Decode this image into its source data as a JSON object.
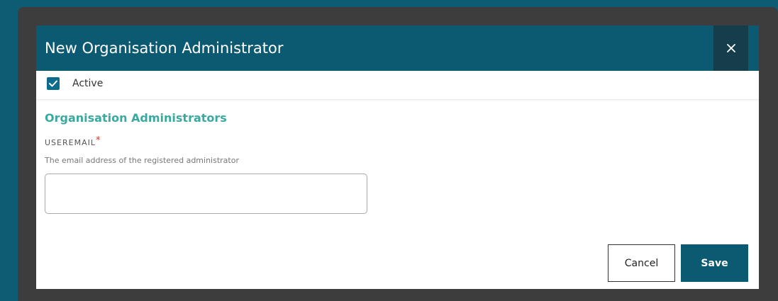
{
  "dialog": {
    "title": "New Organisation Administrator",
    "close_icon": "close-icon"
  },
  "active": {
    "label": "Active",
    "checked": true,
    "icon": "checkmark-icon"
  },
  "section": {
    "title": "Organisation Administrators"
  },
  "useremail": {
    "label": "USEREMAIL",
    "required_marker": "*",
    "help": "The email address of the registered administrator",
    "value": "",
    "placeholder": ""
  },
  "actions": {
    "cancel_label": "Cancel",
    "save_label": "Save"
  },
  "colors": {
    "page_background": "#0d5c73",
    "overlay": "#3d3d3d",
    "header": "#0c5a71",
    "close_button": "#163d4b",
    "section_title": "#3aa9a0",
    "checkbox": "#0c6c8c",
    "required": "#d9302b"
  }
}
